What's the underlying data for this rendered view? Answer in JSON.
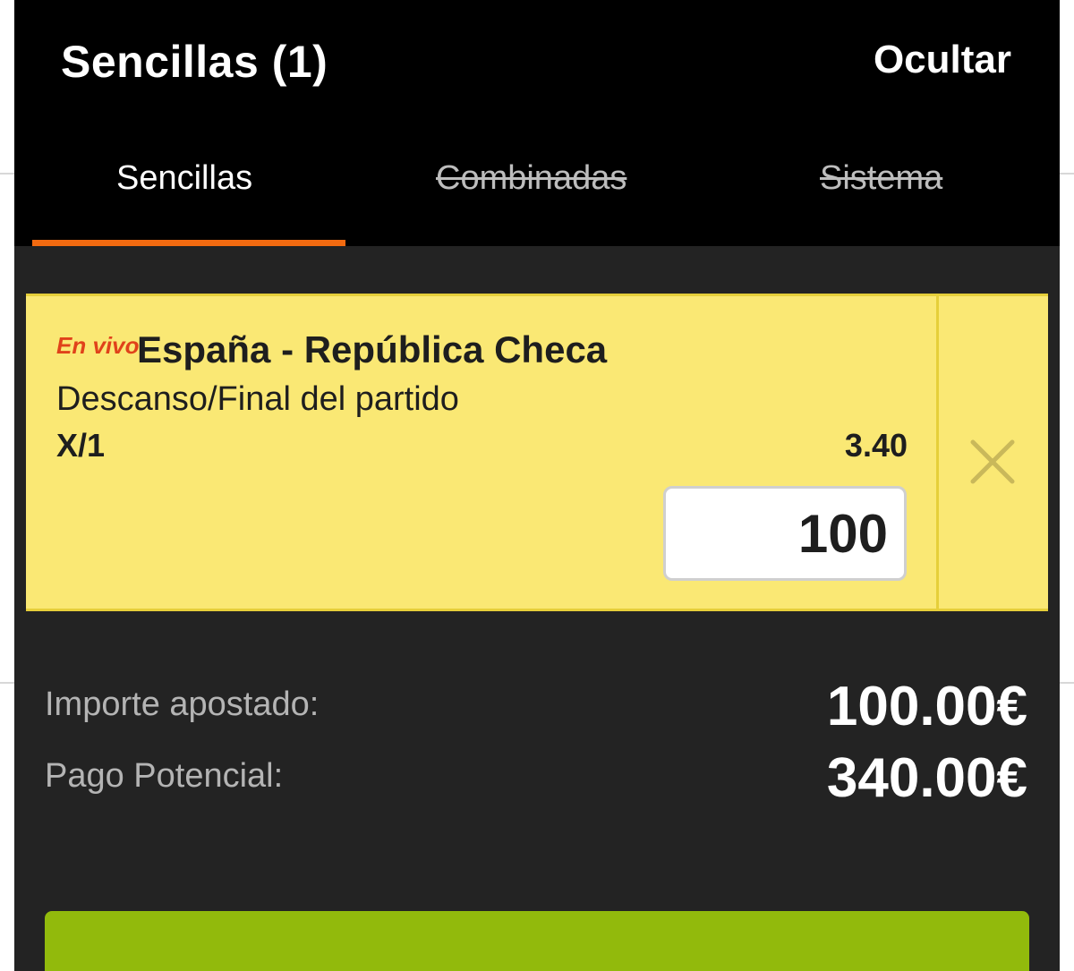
{
  "header": {
    "title": "Sencillas (1)",
    "hide_label": "Ocultar"
  },
  "tabs": [
    {
      "label": "Sencillas",
      "state": "active"
    },
    {
      "label": "Combinadas",
      "state": "disabled"
    },
    {
      "label": "Sistema",
      "state": "disabled"
    }
  ],
  "bet": {
    "live_label": "En vivo",
    "match": "España - República Checa",
    "market": "Descanso/Final del partido",
    "selection": "X/1",
    "odds": "3.40",
    "stake": "100",
    "remove_icon": "close-icon"
  },
  "summary": {
    "stake_label": "Importe apostado:",
    "stake_value": "100.00€",
    "payout_label": "Pago Potencial:",
    "payout_value": "340.00€"
  },
  "confirm": {
    "label": ""
  },
  "colors": {
    "accent": "#f26a10",
    "bet_card": "#fae874",
    "live": "#e0421a",
    "confirm": "#92ba0c",
    "panel": "#232323",
    "header": "#000000"
  }
}
